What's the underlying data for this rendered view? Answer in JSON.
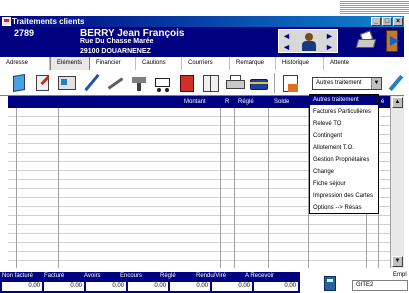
{
  "window": {
    "title": "Traitements clients"
  },
  "header": {
    "client_id": "2789",
    "client_name": "BERRY Jean François",
    "street": "Rue Du Chasse Marée",
    "city": "29100 DOUARNENEZ"
  },
  "tabs": [
    {
      "label": "Adresse",
      "active": false
    },
    {
      "label": "Eléments",
      "active": true
    },
    {
      "label": "Financier",
      "active": false
    },
    {
      "label": "Cautions",
      "active": false
    },
    {
      "label": "Courriers",
      "active": false
    },
    {
      "label": "Remarque",
      "active": false
    },
    {
      "label": "Historique",
      "active": false
    },
    {
      "label": "Attente",
      "active": false
    }
  ],
  "toolbar": {
    "combo_value": "Autres traitement"
  },
  "grid": {
    "columns": [
      "Montant",
      "R",
      "Réglé",
      "Solde",
      "é"
    ]
  },
  "dropdown": {
    "items": [
      "Autres traitement",
      "Factures Particulières",
      "Relevé TO",
      "Contingent",
      "Allotement T.O.",
      "Gestion Propriétaires",
      "Change",
      "Fiche séjour",
      "Impression des Cartes",
      "Options --> Résas"
    ],
    "selected_index": 0
  },
  "footer": {
    "labels": [
      "Non facturé",
      "Facturé",
      "Avoirs",
      "Encours",
      "Réglé",
      "Rendu/Viré",
      "A Recevoir"
    ],
    "values": [
      "0.00",
      "0.00",
      "0.00",
      "0.00",
      "0.00",
      "0.00",
      "0.00"
    ]
  },
  "employee": {
    "label": "Empl",
    "value": "GITE2"
  },
  "colors": {
    "title_bar": "#000080",
    "header_band": "#000080",
    "selected_item": "#000080"
  }
}
